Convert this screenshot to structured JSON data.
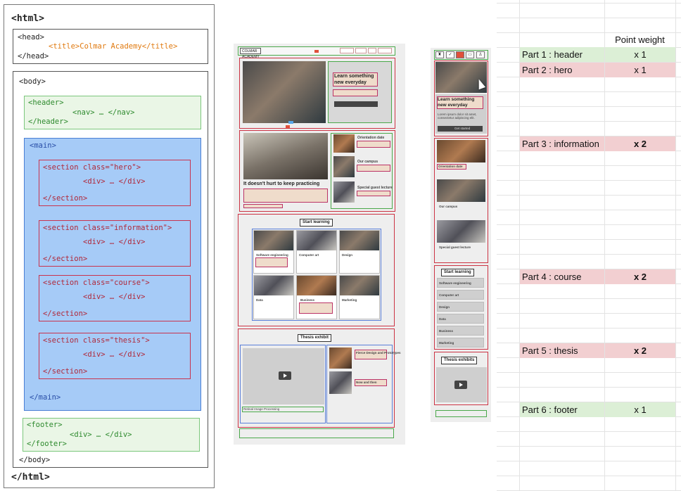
{
  "code": {
    "html_open": "<html>",
    "head_open": "<head>",
    "title": "<title>Colmar Academy</title>",
    "head_close": "</head>",
    "body_open": "<body>",
    "header_open": "<header>",
    "nav": "<nav>  …  </nav>",
    "header_close": "</header>",
    "main_open": "<main>",
    "sections": [
      {
        "open": "<section class=\"hero\">",
        "div": "<div>  …  </div>",
        "close": "</section>"
      },
      {
        "open": "<section class=\"information\">",
        "div": "<div>  …  </div>",
        "close": "</section>"
      },
      {
        "open": "<section class=\"course\">",
        "div": "<div>  …  </div>",
        "close": "</section>"
      },
      {
        "open": "<section class=\"thesis\">",
        "div": "<div>  …  </div>",
        "close": "</section>"
      }
    ],
    "main_close": "</main>",
    "footer_open": "<footer>",
    "footer_div": "<div>  …  </div>",
    "footer_close": "</footer>",
    "body_close": "</body>",
    "html_close": "</html>"
  },
  "desktop": {
    "logo": "COLMAR ACADEMY",
    "hero_heading": "Learn something new everyday",
    "hero_text": "Lorem ipsum dolor sit amet, consectetur adipiscing elit.",
    "info_heading": "It doesn't hurt to keep practicing",
    "info_items": [
      "Orientation date",
      "Our campus",
      "Special guest lecture"
    ],
    "course_heading": "Start learning",
    "courses": [
      "Software engineering",
      "Computer art",
      "Design",
      "Data",
      "Business",
      "Marketing"
    ],
    "thesis_heading": "Thesis exhibit",
    "thesis_items": [
      "Retinal Image Processing",
      "Fierce Design and Prototypes",
      "Now and then"
    ]
  },
  "mobile": {
    "hero_heading": "Learn something new everyday",
    "hero_text": "Lorem ipsum dolor sit amet, consectetur adipiscing elit.",
    "hero_button": "Get started",
    "info_items": [
      "Orientation date",
      "Our campus",
      "Special guest lecture"
    ],
    "course_heading": "Start learning",
    "courses": [
      "Software engineering",
      "Computer art",
      "Design",
      "Data",
      "Business",
      "Marketing"
    ],
    "thesis_heading": "Thesis exhibits"
  },
  "sheet": {
    "header": "Point weight",
    "rows": [
      {
        "part": "Part 1 : header",
        "weight": "x 1",
        "color": "#dcefd6",
        "bold": false
      },
      {
        "part": "Part 2 : hero",
        "weight": "x 1",
        "color": "#f2cfd1",
        "bold": false
      },
      {
        "part": "Part 3 : information",
        "weight": "x 2",
        "color": "#f2cfd1",
        "bold": true
      },
      {
        "part": "Part 4 : course",
        "weight": "x 2",
        "color": "#f2cfd1",
        "bold": true
      },
      {
        "part": "Part 5 : thesis",
        "weight": "x 2",
        "color": "#f2cfd1",
        "bold": true
      },
      {
        "part": "Part 6 : footer",
        "weight": "x 1",
        "color": "#dcefd6",
        "bold": false
      }
    ]
  }
}
